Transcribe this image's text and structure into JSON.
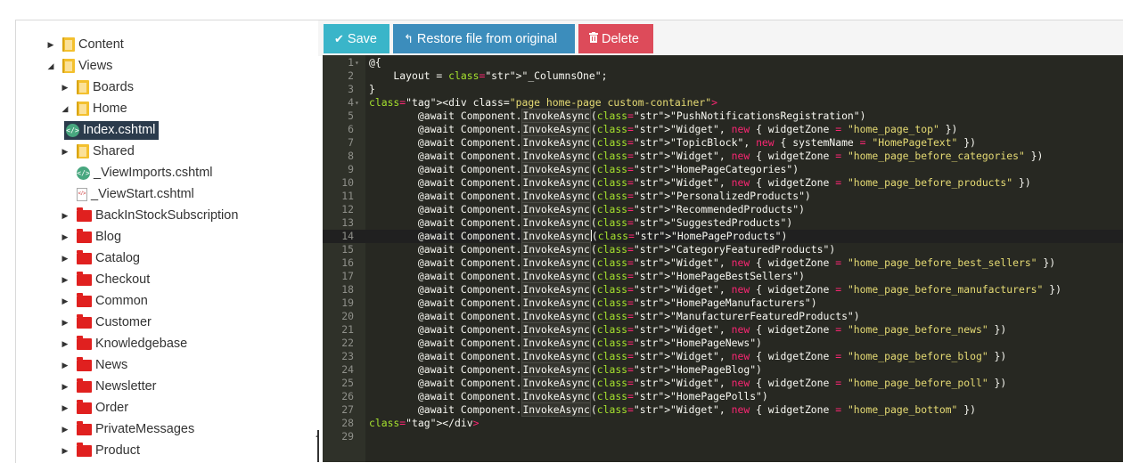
{
  "tree": {
    "items": [
      {
        "label": "Content",
        "icon": "folder-yellow",
        "arrow": "collapsed",
        "level": 2
      },
      {
        "label": "Views",
        "icon": "folder-yellow",
        "arrow": "expanded",
        "level": 2
      },
      {
        "label": "Boards",
        "icon": "folder-yellow",
        "arrow": "collapsed",
        "level": 3
      },
      {
        "label": "Home",
        "icon": "folder-yellow",
        "arrow": "expanded",
        "level": 3
      },
      {
        "label": "Index.cshtml",
        "icon": "file-code",
        "arrow": "none",
        "level": 4,
        "selected": true
      },
      {
        "label": "Shared",
        "icon": "folder-yellow",
        "arrow": "collapsed",
        "level": 3
      },
      {
        "label": "_ViewImports.cshtml",
        "icon": "file-code",
        "arrow": "none",
        "level": 3
      },
      {
        "label": "_ViewStart.cshtml",
        "icon": "file-page",
        "arrow": "none",
        "level": 3
      },
      {
        "label": "BackInStockSubscription",
        "icon": "folder-red",
        "arrow": "collapsed",
        "level": 3
      },
      {
        "label": "Blog",
        "icon": "folder-red",
        "arrow": "collapsed",
        "level": 3
      },
      {
        "label": "Catalog",
        "icon": "folder-red",
        "arrow": "collapsed",
        "level": 3
      },
      {
        "label": "Checkout",
        "icon": "folder-red",
        "arrow": "collapsed",
        "level": 3
      },
      {
        "label": "Common",
        "icon": "folder-red",
        "arrow": "collapsed",
        "level": 3
      },
      {
        "label": "Customer",
        "icon": "folder-red",
        "arrow": "collapsed",
        "level": 3
      },
      {
        "label": "Knowledgebase",
        "icon": "folder-red",
        "arrow": "collapsed",
        "level": 3
      },
      {
        "label": "News",
        "icon": "folder-red",
        "arrow": "collapsed",
        "level": 3
      },
      {
        "label": "Newsletter",
        "icon": "folder-red",
        "arrow": "collapsed",
        "level": 3
      },
      {
        "label": "Order",
        "icon": "folder-red",
        "arrow": "collapsed",
        "level": 3
      },
      {
        "label": "PrivateMessages",
        "icon": "folder-red",
        "arrow": "collapsed",
        "level": 3
      },
      {
        "label": "Product",
        "icon": "folder-red",
        "arrow": "collapsed",
        "level": 3
      }
    ]
  },
  "toolbar": {
    "save_label": "Save",
    "restore_label": "Restore file from original",
    "delete_label": "Delete",
    "save_icon": "check-icon",
    "restore_icon": "undo-icon",
    "delete_icon": "trash-icon"
  },
  "editor": {
    "active_line": 14,
    "lines": [
      "@{",
      "    Layout = \"_ColumnsOne\";",
      "}",
      "<div class=\"page home-page custom-container\">",
      "        @await Component.InvokeAsync(\"PushNotificationsRegistration\")",
      "        @await Component.InvokeAsync(\"Widget\", new { widgetZone = \"home_page_top\" })",
      "        @await Component.InvokeAsync(\"TopicBlock\", new { systemName = \"HomePageText\" })",
      "        @await Component.InvokeAsync(\"Widget\", new { widgetZone = \"home_page_before_categories\" })",
      "        @await Component.InvokeAsync(\"HomePageCategories\")",
      "        @await Component.InvokeAsync(\"Widget\", new { widgetZone = \"home_page_before_products\" })",
      "        @await Component.InvokeAsync(\"PersonalizedProducts\")",
      "        @await Component.InvokeAsync(\"RecommendedProducts\")",
      "        @await Component.InvokeAsync(\"SuggestedProducts\")",
      "        @await Component.InvokeAsync(\"HomePageProducts\")",
      "        @await Component.InvokeAsync(\"CategoryFeaturedProducts\")",
      "        @await Component.InvokeAsync(\"Widget\", new { widgetZone = \"home_page_before_best_sellers\" })",
      "        @await Component.InvokeAsync(\"HomePageBestSellers\")",
      "        @await Component.InvokeAsync(\"Widget\", new { widgetZone = \"home_page_before_manufacturers\" })",
      "        @await Component.InvokeAsync(\"HomePageManufacturers\")",
      "        @await Component.InvokeAsync(\"ManufacturerFeaturedProducts\")",
      "        @await Component.InvokeAsync(\"Widget\", new { widgetZone = \"home_page_before_news\" })",
      "        @await Component.InvokeAsync(\"HomePageNews\")",
      "        @await Component.InvokeAsync(\"Widget\", new { widgetZone = \"home_page_before_blog\" })",
      "        @await Component.InvokeAsync(\"HomePageBlog\")",
      "        @await Component.InvokeAsync(\"Widget\", new { widgetZone = \"home_page_before_poll\" })",
      "        @await Component.InvokeAsync(\"HomePagePolls\")",
      "        @await Component.InvokeAsync(\"Widget\", new { widgetZone = \"home_page_bottom\" })",
      "</div>",
      ""
    ],
    "folds": [
      1,
      4
    ]
  },
  "colors": {
    "editor_bg": "#272822",
    "save_btn": "#3ab5c9",
    "restore_btn": "#3c8dbc",
    "delete_btn": "#dd4b5a",
    "selected_node": "#2b3b4c"
  }
}
